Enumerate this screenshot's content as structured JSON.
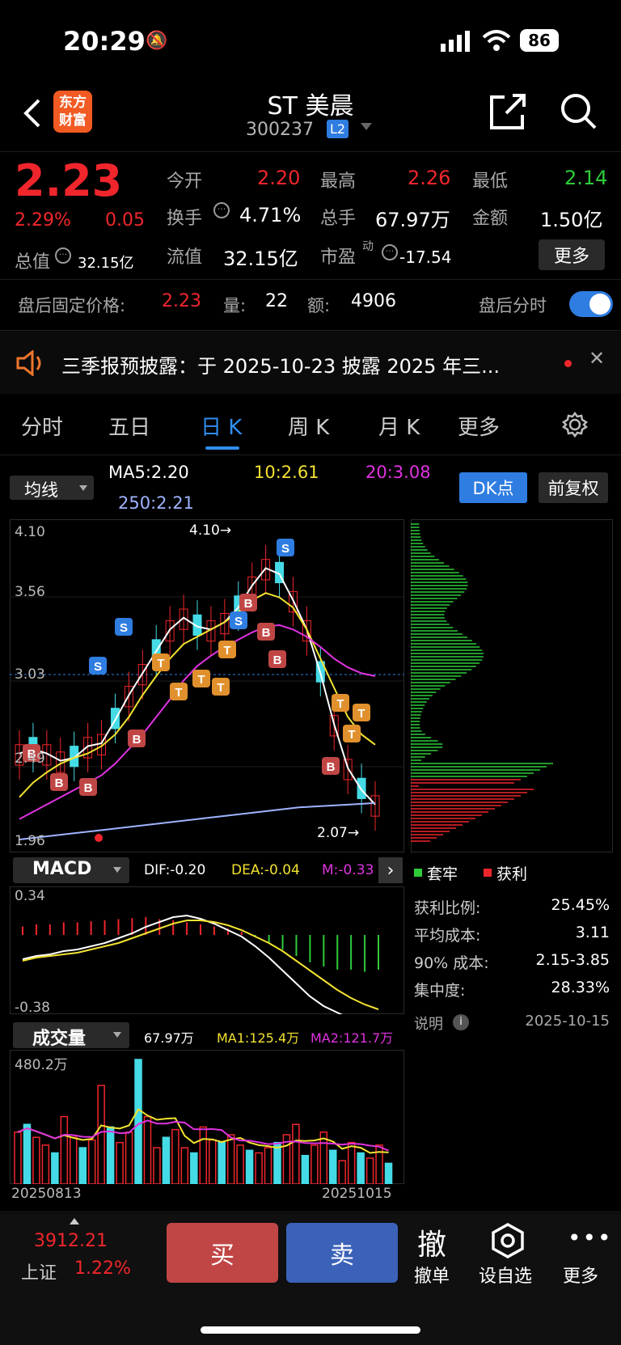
{
  "status_bar": {
    "time": "20:29",
    "battery": "86"
  },
  "header": {
    "title": "ST 美晨",
    "code": "300237",
    "level": "L2",
    "logo": "东方财富"
  },
  "quote": {
    "price": "2.23",
    "pct": "2.29%",
    "change": "0.05",
    "open_label": "今开",
    "open": "2.20",
    "high_label": "最高",
    "high": "2.26",
    "low_label": "最低",
    "low": "2.14",
    "turnover_label": "换手",
    "turnover": "4.71%",
    "volume_label": "总手",
    "volume": "67.97万",
    "amount_label": "金额",
    "amount": "1.50亿",
    "mcap_label": "总值",
    "mcap": "32.15亿",
    "float_label": "流值",
    "float": "32.15亿",
    "pe_label": "市盈",
    "pe_sup": "动",
    "pe": "-17.54",
    "more": "更多"
  },
  "after_hours": {
    "label": "盘后固定价格:",
    "price": "2.23",
    "vol_label": "量:",
    "vol": "22",
    "amt_label": "额:",
    "amt": "4906",
    "toggle_label": "盘后分时",
    "toggle_on": true
  },
  "notice": {
    "text": "三季报预披露：于 2025-10-23 披露 2025 年三..."
  },
  "tabs": [
    "分时",
    "五日",
    "日 K",
    "周 K",
    "月 K",
    "更多"
  ],
  "active_tab": 2,
  "ma_bar": {
    "selector": "均线",
    "ma5": "MA5:2.20",
    "ma10": "10:2.61",
    "ma20": "20:3.08",
    "ma250": "250:2.21",
    "dk": "DK点",
    "fq": "前复权"
  },
  "kline": {
    "y_labels": [
      "4.10",
      "3.56",
      "3.03",
      "2.49",
      "1.96"
    ],
    "max_mark": "4.10→",
    "min_mark": "2.07→"
  },
  "macd": {
    "selector": "MACD",
    "dif": "DIF:-0.20",
    "dea": "DEA:-0.04",
    "m": "M:-0.33",
    "ytop": "0.34",
    "ybot": "-0.38"
  },
  "vol_panel": {
    "selector": "成交量",
    "v": "67.97万",
    "ma1": "MA1:125.4万",
    "ma2": "MA2:121.7万",
    "ytop": "480.2万",
    "d_start": "20250813",
    "d_end": "20251015"
  },
  "chip": {
    "legend_trap": "套牢",
    "legend_profit": "获利",
    "rows": [
      {
        "label": "获利比例:",
        "value": "25.45%"
      },
      {
        "label": "平均成本:",
        "value": "3.11"
      },
      {
        "label": "90% 成本:",
        "value": "2.15-3.85"
      },
      {
        "label": "集中度:",
        "value": "28.33%"
      }
    ],
    "note": "说明",
    "date": "2025-10-15"
  },
  "bottom": {
    "index_value": "3912.21",
    "index_name": "上证",
    "index_pct": "1.22%",
    "buy": "买",
    "sell": "卖",
    "withdraw_icon": "撤",
    "withdraw": "撤单",
    "fav": "设自选",
    "more": "更多"
  },
  "colors": {
    "up": "#f0262c",
    "down": "#2ecc3a",
    "candle_down": "#45dbe6",
    "ma5": "#ffffff",
    "ma10": "#f2e230",
    "ma20": "#e033e0",
    "ma250": "#9fb3ff",
    "accent": "#2f7de1"
  },
  "chart_data": [
    {
      "type": "line",
      "title": "",
      "y_range": [
        1.96,
        4.1
      ],
      "series": [
        {
          "name": "MA5",
          "values": [
            2.55,
            2.58,
            2.55,
            2.5,
            2.52,
            2.6,
            2.62,
            2.78,
            2.95,
            3.1,
            3.25,
            3.4,
            3.48,
            3.42,
            3.4,
            3.45,
            3.55,
            3.7,
            3.82,
            3.78,
            3.6,
            3.4,
            3.1,
            2.75,
            2.45,
            2.3,
            2.2
          ]
        },
        {
          "name": "10",
          "values": [
            2.25,
            2.35,
            2.42,
            2.48,
            2.52,
            2.55,
            2.6,
            2.68,
            2.8,
            2.95,
            3.08,
            3.2,
            3.3,
            3.35,
            3.4,
            3.45,
            3.52,
            3.6,
            3.65,
            3.62,
            3.55,
            3.4,
            3.2,
            3.0,
            2.8,
            2.68,
            2.61
          ]
        },
        {
          "name": "20",
          "values": [
            2.1,
            2.15,
            2.2,
            2.25,
            2.3,
            2.35,
            2.4,
            2.48,
            2.58,
            2.68,
            2.8,
            2.92,
            3.05,
            3.15,
            3.22,
            3.28,
            3.33,
            3.38,
            3.42,
            3.43,
            3.4,
            3.35,
            3.28,
            3.2,
            3.14,
            3.1,
            3.08
          ]
        },
        {
          "name": "250",
          "values": [
            1.96,
            1.98,
            2.0,
            2.02,
            2.04,
            2.06,
            2.08,
            2.1,
            2.12,
            2.14,
            2.16,
            2.18,
            2.19,
            2.2,
            2.21
          ]
        }
      ]
    },
    {
      "type": "bar",
      "title": "",
      "series": [
        {
          "name": "MACD",
          "values": [
            0.08,
            0.1,
            0.1,
            0.12,
            0.12,
            0.13,
            0.14,
            0.15,
            0.16,
            0.17,
            0.15,
            0.14,
            0.12,
            0.1,
            0.08,
            0.06,
            0.03,
            -0.02,
            -0.08,
            -0.14,
            -0.2,
            -0.26,
            -0.3,
            -0.33,
            -0.33,
            -0.35,
            -0.33
          ]
        }
      ]
    },
    {
      "type": "bar",
      "title": "",
      "series": [
        {
          "name": "成交量",
          "values": [
            200,
            230,
            180,
            150,
            120,
            260,
            180,
            140,
            170,
            380,
            220,
            160,
            200,
            480,
            260,
            140,
            180,
            210,
            140,
            120,
            220,
            170,
            160,
            190,
            150,
            130,
            120,
            140,
            160,
            190,
            230,
            110,
            150,
            200,
            130,
            90,
            160,
            120,
            100,
            150,
            80
          ]
        }
      ]
    }
  ]
}
